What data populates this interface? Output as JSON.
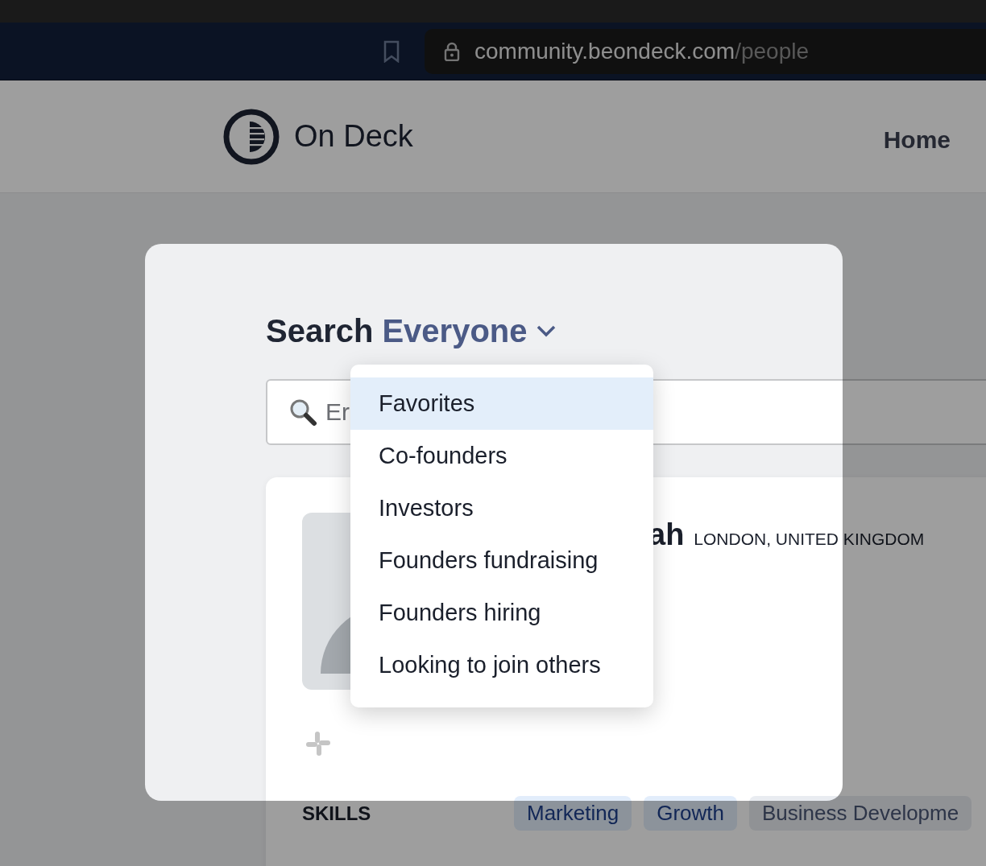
{
  "browser": {
    "url_host": "community.beondeck.com",
    "url_path": "/people"
  },
  "header": {
    "brand": "On Deck",
    "nav": [
      "Home"
    ]
  },
  "search": {
    "label": "Search",
    "scope": "Everyone",
    "placeholder": "Er"
  },
  "scope_menu": [
    {
      "label": "Favorites",
      "selected": true
    },
    {
      "label": "Co-founders",
      "selected": false
    },
    {
      "label": "Investors",
      "selected": false
    },
    {
      "label": "Founders fundraising",
      "selected": false
    },
    {
      "label": "Founders hiring",
      "selected": false
    },
    {
      "label": "Looking to join others",
      "selected": false
    }
  ],
  "profile": {
    "name": "ah",
    "location": "LONDON, UNITED KINGDOM",
    "skills_label": "SKILLS",
    "skills": [
      {
        "label": "Marketing",
        "kind": "primary"
      },
      {
        "label": "Growth",
        "kind": "primary"
      },
      {
        "label": "Business Developme",
        "kind": "secondary"
      }
    ]
  }
}
